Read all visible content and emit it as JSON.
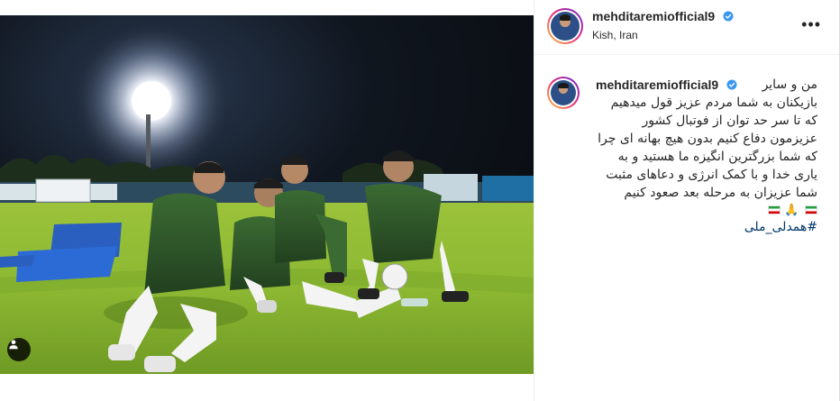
{
  "post": {
    "author": {
      "username": "mehditaremiofficial9",
      "verified": true,
      "avatar_icon": "profile-photo"
    },
    "location": "Kish, Iran",
    "more_icon": "more-horizontal-icon",
    "tag_icon": "user-tag-icon",
    "caption": {
      "first_line": "من و سایر",
      "lines": [
        "بازیکنان به شما مردم عزیز قول میدهیم",
        "که تا سر حد توان از فوتبال کشور",
        "عزیزمون دفاع کنیم بدون هیچ بهانه ای چرا",
        "که شما بزرگترین انگیزه ما هستید و به",
        "یاری خدا و با کمک انرژی و دعاهای مثبت",
        "شما عزیزان به مرحله بعد صعود کنیم"
      ],
      "emoji": "🙏",
      "flag_icon": "iran-flag",
      "hashtag": "#همدلی_ملی"
    },
    "colors": {
      "verified_blue": "#3897f0",
      "hashtag": "#00376b",
      "text": "#262626",
      "jersey_green": "#2f5a2a"
    }
  }
}
